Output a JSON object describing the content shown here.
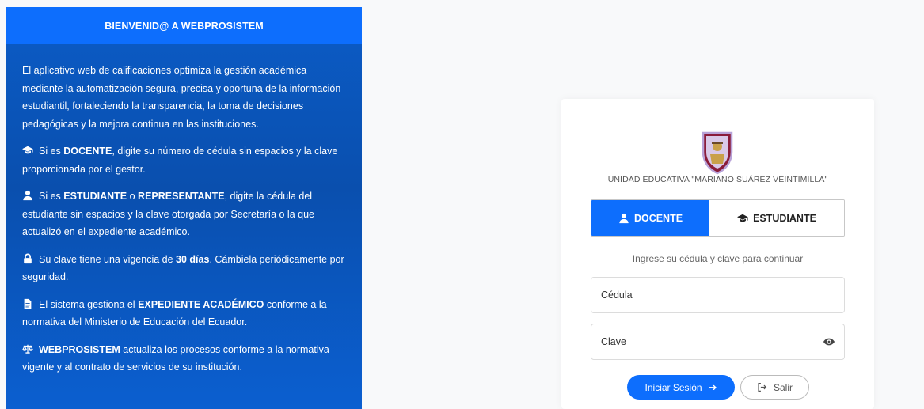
{
  "welcome": {
    "title": "BIENVENID@ A WEBPROSISTEM",
    "intro": "El aplicativo web de calificaciones optimiza la gestión académica mediante la automatización segura, precisa y oportuna de la información estudiantil, fortaleciendo la transparencia, la toma de decisiones pedagógicas y la mejora continua en las instituciones.",
    "docente": {
      "icon": "graduation-cap-icon",
      "pre": "Si es ",
      "bold": "DOCENTE",
      "post": ", digite su número de cédula sin espacios y la clave proporcionada por el gestor."
    },
    "estudiante": {
      "icon": "user-icon",
      "pre": "Si es ",
      "bold1": "ESTUDIANTE",
      "mid": " o ",
      "bold2": "REPRESENTANTE",
      "post": ", digite la cédula del estudiante sin espacios y la clave otorgada por Secretaría o la que actualizó en el expediente académico."
    },
    "clave": {
      "icon": "lock-icon",
      "pre": "Su clave tiene una vigencia de ",
      "bold": "30 días",
      "post": ". Cámbiela periódicamente por seguridad."
    },
    "expediente": {
      "icon": "file-icon",
      "pre": "El sistema gestiona el ",
      "bold": "EXPEDIENTE ACADÉMICO",
      "post": " conforme a la normativa del Ministerio de Educación del Ecuador."
    },
    "normativa": {
      "icon": "balance-scale-icon",
      "bold": "WEBPROSISTEM",
      "post": " actualiza los procesos conforme a la normativa vigente y al contrato de servicios de su institución."
    }
  },
  "login": {
    "school_name": "UNIDAD EDUCATIVA \"MARIANO SUÁREZ VEINTIMILLA\"",
    "tabs": [
      {
        "label": "DOCENTE",
        "icon": "user-icon",
        "active": true
      },
      {
        "label": "ESTUDIANTE",
        "icon": "graduation-cap-icon",
        "active": false
      }
    ],
    "hint": "Ingrese su cédula y clave para continuar",
    "cedula_placeholder": "Cédula",
    "clave_placeholder": "Clave",
    "login_button": "Iniciar Sesión",
    "exit_button": "Salir"
  },
  "colors": {
    "primary": "#0d6efd",
    "panel_dark": "#0a4fae",
    "background": "#f8f9fa"
  }
}
